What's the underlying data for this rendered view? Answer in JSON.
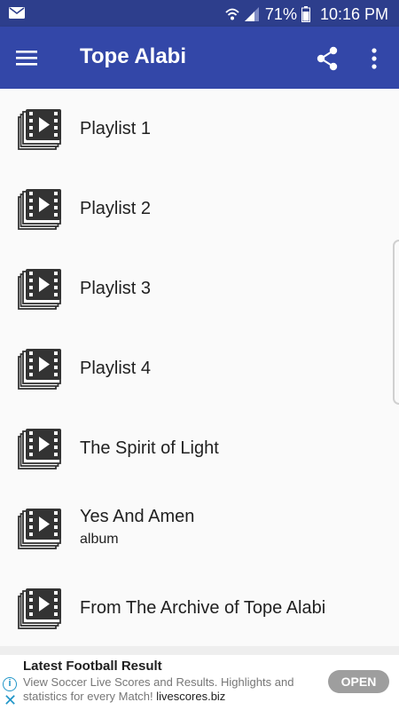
{
  "status_bar": {
    "battery_percent": "71%",
    "time": "10:16 PM"
  },
  "app_bar": {
    "title": "Tope Alabi"
  },
  "playlists": [
    {
      "title": "Playlist 1",
      "subtitle": ""
    },
    {
      "title": "Playlist 2",
      "subtitle": ""
    },
    {
      "title": "Playlist 3",
      "subtitle": ""
    },
    {
      "title": "Playlist 4",
      "subtitle": ""
    },
    {
      "title": "The Spirit of Light",
      "subtitle": ""
    },
    {
      "title": "Yes And Amen",
      "subtitle": "album"
    },
    {
      "title": "From The Archive of Tope Alabi",
      "subtitle": ""
    }
  ],
  "ad": {
    "headline": "Latest Football Result",
    "body": "View Soccer Live Scores and Results. Highlights and statistics for every Match!",
    "link": "livescores.biz",
    "button": "OPEN"
  },
  "colors": {
    "status_bar": "#2d3e8c",
    "app_bar": "#3347a8",
    "ad_accent": "#2196c8",
    "open_button": "#9e9e9e"
  },
  "icons": [
    "mail-icon",
    "wifi-icon",
    "signal-icon",
    "battery-icon",
    "menu-icon",
    "share-icon",
    "more-vert-icon",
    "video-playlist-icon",
    "info-icon",
    "close-icon"
  ]
}
